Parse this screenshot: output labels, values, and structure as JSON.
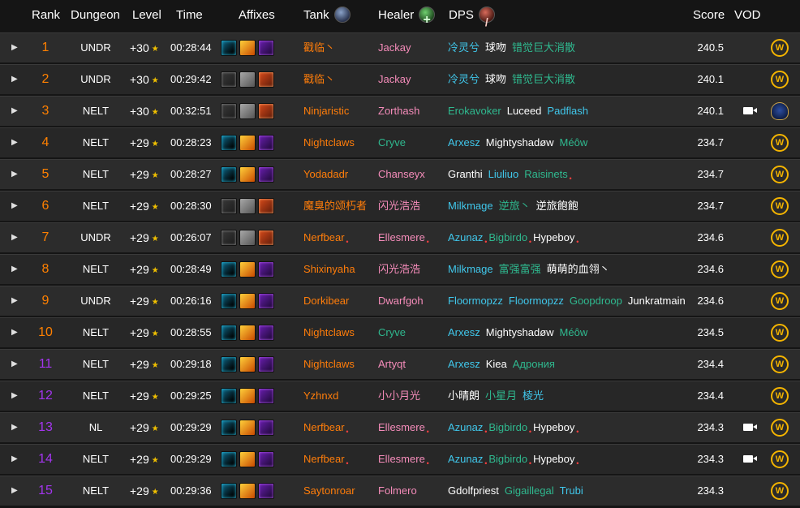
{
  "header": {
    "rank": "Rank",
    "dungeon": "Dungeon",
    "level": "Level",
    "time": "Time",
    "affixes": "Affixes",
    "tank": "Tank",
    "healer": "Healer",
    "dps": "DPS",
    "score": "Score",
    "vod": "VOD"
  },
  "icons": {
    "expand": "caret-right-icon",
    "level_star": "star-icon",
    "tank": "shield-icon",
    "healer": "healer-cross-icon",
    "dps": "sword-icon",
    "vod": "video-camera-icon",
    "source_wow": "wow-logo-icon",
    "source_alliance": "alliance-crest-icon"
  },
  "colors": {
    "background": "#151515",
    "row": "#2a2a2a",
    "rank_top": "#ff8000",
    "rank_lower": "#a335ee",
    "star": "#f0c000",
    "wow_logo": "#f4b400"
  },
  "rows": [
    {
      "rank": "1",
      "rank_color": "orange",
      "dungeon": "UNDR",
      "level": "+30",
      "time": "00:28:44",
      "affixes": [
        "bolster",
        "volcanic",
        "tyrannical"
      ],
      "tank": {
        "name": "戳临丶",
        "class": "c-dh",
        "marked": false
      },
      "healer": {
        "name": "Jackay",
        "class": "c-pal",
        "marked": false
      },
      "dps": [
        {
          "name": "冷灵兮",
          "class": "c-mage",
          "marked": false
        },
        {
          "name": "球吻",
          "class": "c-priest",
          "marked": false
        },
        {
          "name": "错觉巨大消散",
          "class": "c-monk",
          "marked": false
        }
      ],
      "score": "240.5",
      "vod": false,
      "source": "wow"
    },
    {
      "rank": "2",
      "rank_color": "orange",
      "dungeon": "UNDR",
      "level": "+30",
      "time": "00:29:42",
      "affixes": [
        "grievous",
        "necrotic",
        "fortified"
      ],
      "tank": {
        "name": "戳临丶",
        "class": "c-dh",
        "marked": false
      },
      "healer": {
        "name": "Jackay",
        "class": "c-pal",
        "marked": false
      },
      "dps": [
        {
          "name": "冷灵兮",
          "class": "c-mage",
          "marked": false
        },
        {
          "name": "球吻",
          "class": "c-priest",
          "marked": false
        },
        {
          "name": "错觉巨大消散",
          "class": "c-monk",
          "marked": false
        }
      ],
      "score": "240.1",
      "vod": false,
      "source": "wow"
    },
    {
      "rank": "3",
      "rank_color": "orange",
      "dungeon": "NELT",
      "level": "+30",
      "time": "00:32:51",
      "affixes": [
        "grievous",
        "necrotic",
        "fortified"
      ],
      "tank": {
        "name": "Ninjaristic",
        "class": "c-dh",
        "marked": false
      },
      "healer": {
        "name": "Zorthash",
        "class": "c-pal",
        "marked": false
      },
      "dps": [
        {
          "name": "Erokavoker",
          "class": "c-monk",
          "marked": false
        },
        {
          "name": "Luceed",
          "class": "c-priest",
          "marked": false
        },
        {
          "name": "Padflash",
          "class": "c-mage",
          "marked": false
        }
      ],
      "score": "240.1",
      "vod": true,
      "source": "alliance"
    },
    {
      "rank": "4",
      "rank_color": "orange",
      "dungeon": "NELT",
      "level": "+29",
      "time": "00:28:23",
      "affixes": [
        "bolster",
        "volcanic",
        "tyrannical"
      ],
      "tank": {
        "name": "Nightclaws",
        "class": "c-dh",
        "marked": false
      },
      "healer": {
        "name": "Cryve",
        "class": "c-monk",
        "marked": false
      },
      "dps": [
        {
          "name": "Arxesz",
          "class": "c-mage",
          "marked": false
        },
        {
          "name": "Mightyshadøw",
          "class": "c-priest",
          "marked": false
        },
        {
          "name": "Méôw",
          "class": "c-monk",
          "marked": false
        }
      ],
      "score": "234.7",
      "vod": false,
      "source": "wow"
    },
    {
      "rank": "5",
      "rank_color": "orange",
      "dungeon": "NELT",
      "level": "+29",
      "time": "00:28:27",
      "affixes": [
        "bolster",
        "volcanic",
        "tyrannical"
      ],
      "tank": {
        "name": "Yodadadr",
        "class": "c-dh",
        "marked": false
      },
      "healer": {
        "name": "Chanseyx",
        "class": "c-pal",
        "marked": false
      },
      "dps": [
        {
          "name": "Granthi",
          "class": "c-priest",
          "marked": false
        },
        {
          "name": "Liuliuo",
          "class": "c-mage",
          "marked": false
        },
        {
          "name": "Raisinets",
          "class": "c-monk",
          "marked": true
        }
      ],
      "score": "234.7",
      "vod": false,
      "source": "wow"
    },
    {
      "rank": "6",
      "rank_color": "orange",
      "dungeon": "NELT",
      "level": "+29",
      "time": "00:28:30",
      "affixes": [
        "grievous",
        "necrotic",
        "fortified"
      ],
      "tank": {
        "name": "魔臭的颂朽者",
        "class": "c-dh",
        "marked": false
      },
      "healer": {
        "name": "闪光浩浩",
        "class": "c-pal",
        "marked": false
      },
      "dps": [
        {
          "name": "Milkmage",
          "class": "c-mage",
          "marked": false
        },
        {
          "name": "逆旅丶",
          "class": "c-monk",
          "marked": false
        },
        {
          "name": "逆旅飽飽",
          "class": "c-priest",
          "marked": false
        }
      ],
      "score": "234.7",
      "vod": false,
      "source": "wow"
    },
    {
      "rank": "7",
      "rank_color": "orange",
      "dungeon": "UNDR",
      "level": "+29",
      "time": "00:26:07",
      "affixes": [
        "grievous",
        "necrotic",
        "fortified"
      ],
      "tank": {
        "name": "Nerfbear",
        "class": "c-dh",
        "marked": true
      },
      "healer": {
        "name": "Ellesmere",
        "class": "c-pal",
        "marked": true
      },
      "dps": [
        {
          "name": "Azunaz",
          "class": "c-mage",
          "marked": true
        },
        {
          "name": "Bigbirdo",
          "class": "c-monk",
          "marked": true
        },
        {
          "name": "Hypeboy",
          "class": "c-priest",
          "marked": true
        }
      ],
      "score": "234.6",
      "vod": false,
      "source": "wow"
    },
    {
      "rank": "8",
      "rank_color": "orange",
      "dungeon": "NELT",
      "level": "+29",
      "time": "00:28:49",
      "affixes": [
        "bolster",
        "volcanic",
        "tyrannical"
      ],
      "tank": {
        "name": "Shixinyaha",
        "class": "c-dh",
        "marked": false
      },
      "healer": {
        "name": "闪光浩浩",
        "class": "c-pal",
        "marked": false
      },
      "dps": [
        {
          "name": "Milkmage",
          "class": "c-mage",
          "marked": false
        },
        {
          "name": "富强富强",
          "class": "c-monk",
          "marked": false
        },
        {
          "name": "萌萌的血翎丶",
          "class": "c-priest",
          "marked": false
        }
      ],
      "score": "234.6",
      "vod": false,
      "source": "wow"
    },
    {
      "rank": "9",
      "rank_color": "orange",
      "dungeon": "UNDR",
      "level": "+29",
      "time": "00:26:16",
      "affixes": [
        "bolster",
        "volcanic",
        "tyrannical"
      ],
      "tank": {
        "name": "Dorkibear",
        "class": "c-dh",
        "marked": false
      },
      "healer": {
        "name": "Dwarfgoh",
        "class": "c-pal",
        "marked": false
      },
      "dps": [
        {
          "name": "Floormopzz",
          "class": "c-mage",
          "marked": false
        },
        {
          "name": "Floormopzz",
          "class": "c-mage",
          "marked": false
        },
        {
          "name": "Goopdroop",
          "class": "c-monk",
          "marked": false
        },
        {
          "name": "Junkratmain",
          "class": "c-priest",
          "marked": false
        }
      ],
      "score": "234.6",
      "vod": false,
      "source": "wow"
    },
    {
      "rank": "10",
      "rank_color": "orange",
      "dungeon": "NELT",
      "level": "+29",
      "time": "00:28:55",
      "affixes": [
        "bolster",
        "volcanic",
        "tyrannical"
      ],
      "tank": {
        "name": "Nightclaws",
        "class": "c-dh",
        "marked": false
      },
      "healer": {
        "name": "Cryve",
        "class": "c-monk",
        "marked": false
      },
      "dps": [
        {
          "name": "Arxesz",
          "class": "c-mage",
          "marked": false
        },
        {
          "name": "Mightyshadøw",
          "class": "c-priest",
          "marked": false
        },
        {
          "name": "Méôw",
          "class": "c-monk",
          "marked": false
        }
      ],
      "score": "234.5",
      "vod": false,
      "source": "wow"
    },
    {
      "rank": "11",
      "rank_color": "purple",
      "dungeon": "NELT",
      "level": "+29",
      "time": "00:29:18",
      "affixes": [
        "bolster",
        "volcanic",
        "tyrannical"
      ],
      "tank": {
        "name": "Nightclaws",
        "class": "c-dh",
        "marked": false
      },
      "healer": {
        "name": "Artyqt",
        "class": "c-pal",
        "marked": false
      },
      "dps": [
        {
          "name": "Arxesz",
          "class": "c-mage",
          "marked": false
        },
        {
          "name": "Kiea",
          "class": "c-priest",
          "marked": false
        },
        {
          "name": "Адрония",
          "class": "c-monk",
          "marked": false
        }
      ],
      "score": "234.4",
      "vod": false,
      "source": "wow"
    },
    {
      "rank": "12",
      "rank_color": "purple",
      "dungeon": "NELT",
      "level": "+29",
      "time": "00:29:25",
      "affixes": [
        "bolster",
        "volcanic",
        "tyrannical"
      ],
      "tank": {
        "name": "Yzhnxd",
        "class": "c-dh",
        "marked": false
      },
      "healer": {
        "name": "小小月光",
        "class": "c-pal",
        "marked": false
      },
      "dps": [
        {
          "name": "小晴朗",
          "class": "c-priest",
          "marked": false
        },
        {
          "name": "小星月",
          "class": "c-monk",
          "marked": false
        },
        {
          "name": "棱光",
          "class": "c-mage",
          "marked": false
        }
      ],
      "score": "234.4",
      "vod": false,
      "source": "wow"
    },
    {
      "rank": "13",
      "rank_color": "purple",
      "dungeon": "NL",
      "level": "+29",
      "time": "00:29:29",
      "affixes": [
        "bolster",
        "volcanic",
        "tyrannical"
      ],
      "tank": {
        "name": "Nerfbear",
        "class": "c-dh",
        "marked": true
      },
      "healer": {
        "name": "Ellesmere",
        "class": "c-pal",
        "marked": true
      },
      "dps": [
        {
          "name": "Azunaz",
          "class": "c-mage",
          "marked": true
        },
        {
          "name": "Bigbirdo",
          "class": "c-monk",
          "marked": true
        },
        {
          "name": "Hypeboy",
          "class": "c-priest",
          "marked": true
        }
      ],
      "score": "234.3",
      "vod": true,
      "source": "wow"
    },
    {
      "rank": "14",
      "rank_color": "purple",
      "dungeon": "NELT",
      "level": "+29",
      "time": "00:29:29",
      "affixes": [
        "bolster",
        "volcanic",
        "tyrannical"
      ],
      "tank": {
        "name": "Nerfbear",
        "class": "c-dh",
        "marked": true
      },
      "healer": {
        "name": "Ellesmere",
        "class": "c-pal",
        "marked": true
      },
      "dps": [
        {
          "name": "Azunaz",
          "class": "c-mage",
          "marked": true
        },
        {
          "name": "Bigbirdo",
          "class": "c-monk",
          "marked": true
        },
        {
          "name": "Hypeboy",
          "class": "c-priest",
          "marked": true
        }
      ],
      "score": "234.3",
      "vod": true,
      "source": "wow"
    },
    {
      "rank": "15",
      "rank_color": "purple",
      "dungeon": "NELT",
      "level": "+29",
      "time": "00:29:36",
      "affixes": [
        "bolster",
        "volcanic",
        "tyrannical"
      ],
      "tank": {
        "name": "Saytonroar",
        "class": "c-dh",
        "marked": false
      },
      "healer": {
        "name": "Folmero",
        "class": "c-pal",
        "marked": false
      },
      "dps": [
        {
          "name": "Gdolfpriest",
          "class": "c-priest",
          "marked": false
        },
        {
          "name": "Gigaillegal",
          "class": "c-monk",
          "marked": false
        },
        {
          "name": "Trubi",
          "class": "c-mage",
          "marked": false
        }
      ],
      "score": "234.3",
      "vod": false,
      "source": "wow"
    }
  ]
}
